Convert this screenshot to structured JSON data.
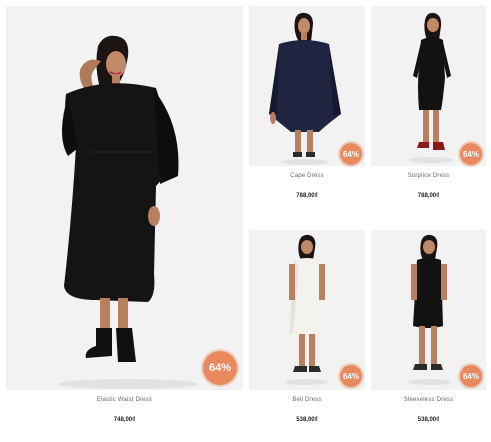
{
  "products": [
    {
      "name": "Elastic Waist Dress",
      "price": "748,00₫",
      "discount": "64%"
    },
    {
      "name": "Cape Dress",
      "price": "788,00₫",
      "discount": "64%"
    },
    {
      "name": "Surplice Dress",
      "price": "788,00₫",
      "discount": "64%"
    },
    {
      "name": "Bell Dress",
      "price": "538,00₫",
      "discount": "64%"
    },
    {
      "name": "Sleeveless Dress",
      "price": "538,00₫",
      "discount": "64%"
    }
  ],
  "colors": {
    "badge": "#e8895f",
    "photo_bg": "#f2f2f2"
  }
}
